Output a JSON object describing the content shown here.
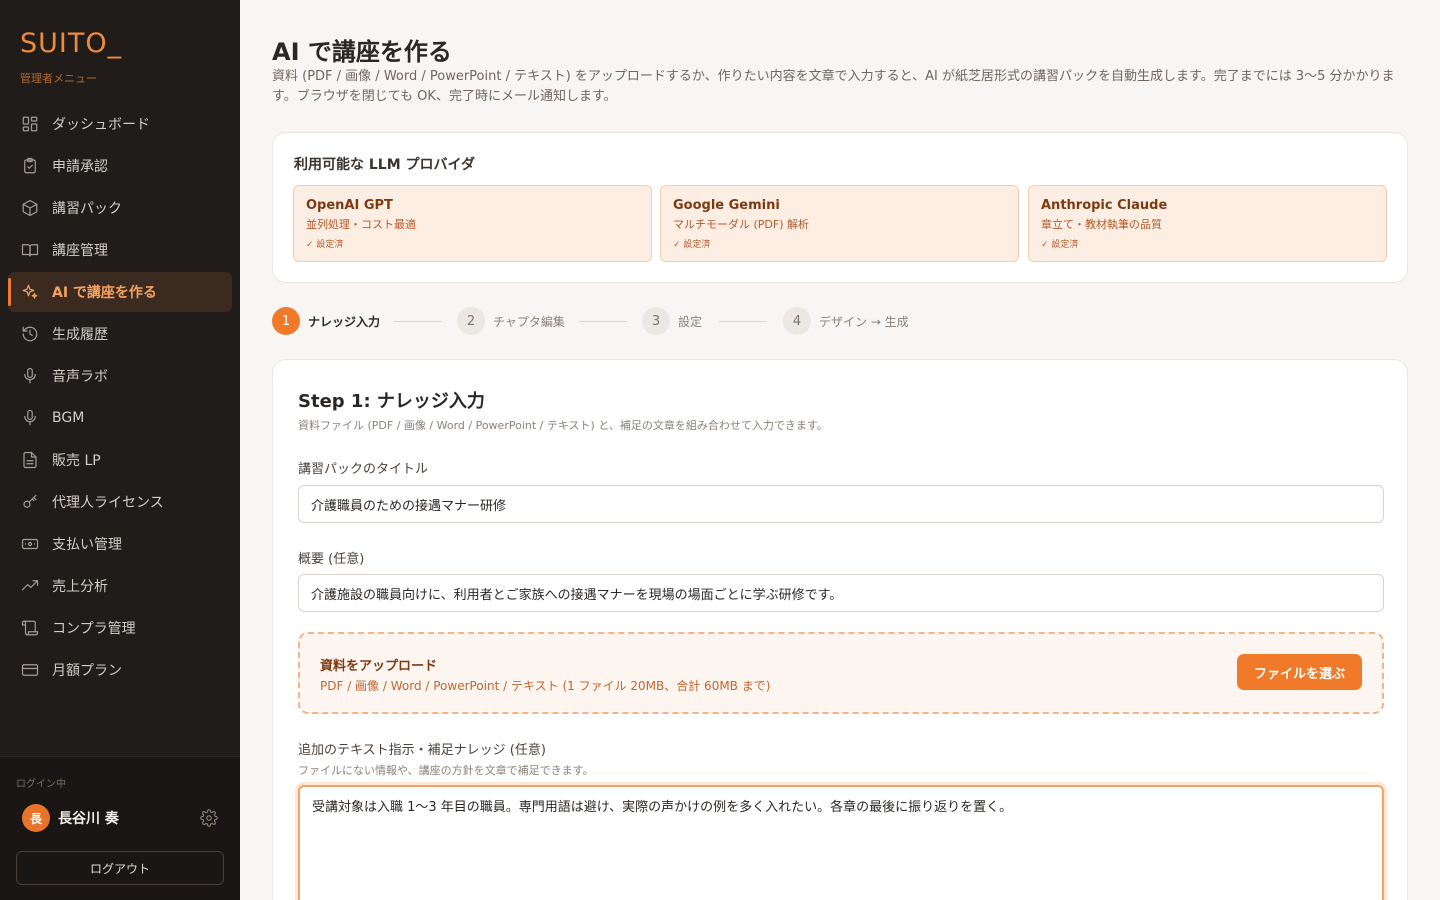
{
  "sidebar": {
    "brand": "SUITO_",
    "brand_sub": "管理者メニュー",
    "items": [
      {
        "label": "ダッシュボード",
        "icon": "dashboard-icon"
      },
      {
        "label": "申請承認",
        "icon": "clipboard-check-icon"
      },
      {
        "label": "講習パック",
        "icon": "package-icon"
      },
      {
        "label": "講座管理",
        "icon": "book-open-icon"
      },
      {
        "label": "AI で講座を作る",
        "icon": "sparkles-icon",
        "active": true
      },
      {
        "label": "生成履歴",
        "icon": "history-icon"
      },
      {
        "label": "音声ラボ",
        "icon": "microphone-icon"
      },
      {
        "label": "BGM",
        "icon": "microphone-icon"
      },
      {
        "label": "販売 LP",
        "icon": "document-icon"
      },
      {
        "label": "代理人ライセンス",
        "icon": "key-icon"
      },
      {
        "label": "支払い管理",
        "icon": "banknote-icon"
      },
      {
        "label": "売上分析",
        "icon": "trending-up-icon"
      },
      {
        "label": "コンプラ管理",
        "icon": "scroll-icon"
      },
      {
        "label": "月額プラン",
        "icon": "credit-card-icon"
      }
    ],
    "login_label": "ログイン中",
    "user": {
      "avatar": "長",
      "name": "長谷川 奏"
    },
    "logout_label": "ログアウト"
  },
  "main": {
    "title": "AI で講座を作る",
    "description": "資料 (PDF / 画像 / Word / PowerPoint / テキスト) をアップロードするか、作りたい内容を文章で入力すると、AI が紙芝居形式の講習パックを自動生成します。完了までには 3〜5 分かかります。ブラウザを閉じても OK、完了時にメール通知します。",
    "providers": {
      "title": "利用可能な LLM プロバイダ",
      "items": [
        {
          "name": "OpenAI GPT",
          "desc": "並列処理・コスト最適",
          "status": "✓ 設定済"
        },
        {
          "name": "Google Gemini",
          "desc": "マルチモーダル (PDF) 解析",
          "status": "✓ 設定済"
        },
        {
          "name": "Anthropic Claude",
          "desc": "章立て・教材執筆の品質",
          "status": "✓ 設定済"
        }
      ]
    },
    "steps": [
      {
        "num": "1",
        "label": "ナレッジ入力"
      },
      {
        "num": "2",
        "label": "チャプタ編集"
      },
      {
        "num": "3",
        "label": "設定"
      },
      {
        "num": "4",
        "label": "デザイン → 生成"
      }
    ],
    "form": {
      "step_title": "Step 1: ナレッジ入力",
      "step_sub": "資料ファイル (PDF / 画像 / Word / PowerPoint / テキスト) と、補足の文章を組み合わせて入力できます。",
      "title_label": "講習パックのタイトル",
      "title_value": "介護職員のための接遇マナー研修",
      "summary_label": "概要 (任意)",
      "summary_value": "介護施設の職員向けに、利用者とご家族への接遇マナーを現場の場面ごとに学ぶ研修です。",
      "upload_title": "資料をアップロード",
      "upload_desc": "PDF / 画像 / Word / PowerPoint / テキスト (1 ファイル 20MB、合計 60MB まで)",
      "upload_button": "ファイルを選ぶ",
      "extra_label": "追加のテキスト指示・補足ナレッジ (任意)",
      "extra_hint": "ファイルにない情報や、講座の方針を文章で補足できます。",
      "extra_value": "受講対象は入職 1〜3 年目の職員。専門用語は避け、実際の声かけの例を多く入れたい。各章の最後に振り返りを置く。"
    }
  }
}
